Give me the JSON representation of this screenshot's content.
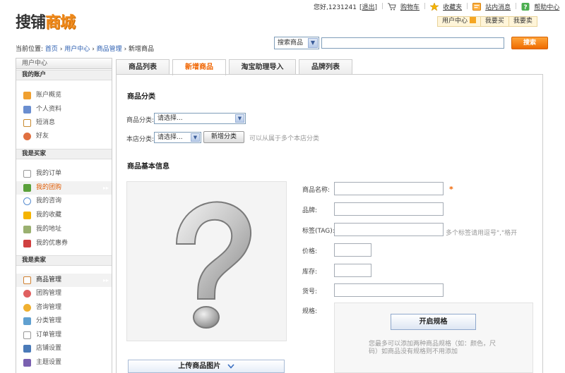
{
  "logo": {
    "part1": "搜铺",
    "part2": "商城"
  },
  "toplinks": {
    "greeting": "您好,1231241",
    "logout": "[退出]",
    "cart": "购物车",
    "favorites": "收藏夹",
    "messages": "站内消息",
    "help": "帮助中心"
  },
  "userbar": {
    "center": "用户中心",
    "buy": "我要买",
    "sell": "我要卖"
  },
  "breadcrumb": {
    "prefix": "当前位置:",
    "home": "首页",
    "user_center": "用户中心",
    "goods_manage": "商品管理",
    "current": "新增商品",
    "sep": "›"
  },
  "search": {
    "select_value": "搜索商品",
    "input_value": "",
    "button": "搜索"
  },
  "sidebar": {
    "title": "用户中心",
    "sections": [
      {
        "title": "我的账户",
        "items": [
          "账户概览",
          "个人资料",
          "短消息",
          "好友"
        ]
      },
      {
        "title": "我是买家",
        "items": [
          "我的订单",
          "我的团购",
          "我的咨询",
          "我的收藏",
          "我的地址",
          "我的优惠券"
        ]
      },
      {
        "title": "我是卖家",
        "items": [
          "商品管理",
          "团购管理",
          "咨询管理",
          "分类管理",
          "订单管理",
          "店铺设置",
          "主题设置"
        ]
      }
    ],
    "arrow": "▸▸"
  },
  "tabs": [
    "商品列表",
    "新增商品",
    "淘宝助理导入",
    "品牌列表"
  ],
  "category": {
    "heading": "商品分类",
    "cat_label": "商品分类:",
    "cat_value": "请选择...",
    "store_label": "本店分类:",
    "store_value": "请选择...",
    "add_button": "新增分类",
    "hint": "可以从属于多个本店分类"
  },
  "basic": {
    "heading": "商品基本信息",
    "name_label": "商品名称:",
    "required_mark": "*",
    "brand_label": "品牌:",
    "tag_label": "标签(TAG):",
    "tag_hint": "多个标签请用逗号\",\"格开",
    "price_label": "价格:",
    "stock_label": "库存:",
    "sku_label": "货号:",
    "spec_label": "规格:",
    "spec_button": "开启规格",
    "spec_hint_1": "您最多可以添加两种商品规格（如：颜色，尺",
    "spec_hint_2": "码）如商品没有规格则不用添加",
    "upload_button": "上传商品图片",
    "placeholder_glyph": "?"
  },
  "colors": {
    "accent": "#f06400",
    "link": "#2a5db0"
  }
}
